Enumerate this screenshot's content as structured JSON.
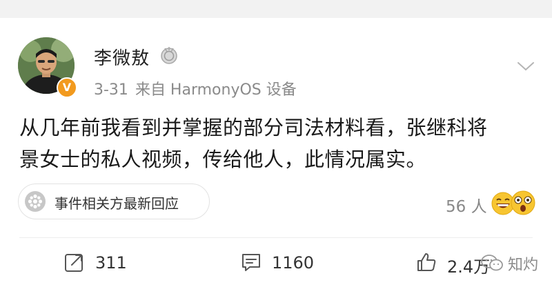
{
  "post": {
    "author": "李微敖",
    "verified_badge_icon": "verified-v-icon",
    "medal_icon": "silver-medal-icon",
    "date": "3-31",
    "source": "来自 HarmonyOS 设备",
    "text_lines": [
      "从几年前我看到并掌握的部分司法材料看，张继科将",
      "景女士的私人视频，传给他人，此情况属实。"
    ]
  },
  "event": {
    "label": "事件相关方最新回应",
    "icon": "event-icon"
  },
  "reactions": {
    "people": "56 人",
    "emoji_icons": [
      "grinning-emoji-icon",
      "shocked-emoji-icon"
    ]
  },
  "actions": {
    "repost_count": "311",
    "comment_count": "1160",
    "like_count": "2.4万"
  },
  "watermark": {
    "text": "知灼"
  },
  "colors": {
    "page_bg": "#f2f2f2",
    "card_bg": "#ffffff",
    "verified_orange": "#f29a1e",
    "meta_gray": "#8a8a8a"
  }
}
